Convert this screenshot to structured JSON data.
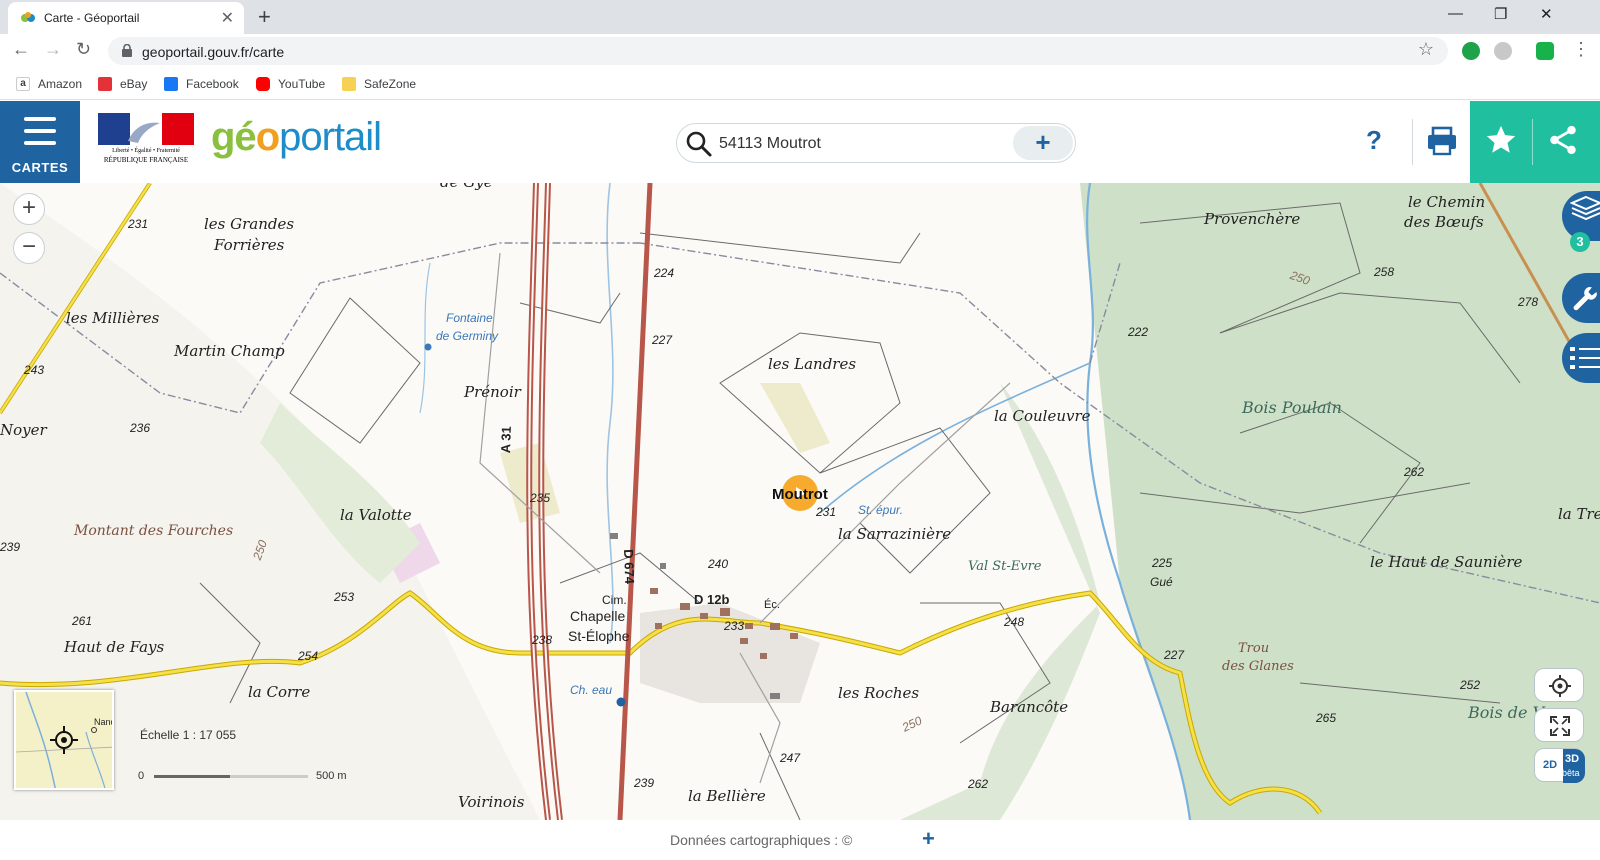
{
  "browser": {
    "tab_title": "Carte - Géoportail",
    "url": "geoportail.gouv.fr/carte",
    "bookmarks": [
      "Amazon",
      "eBay",
      "Facebook",
      "YouTube",
      "SafeZone"
    ]
  },
  "header": {
    "cartes_label": "CARTES",
    "marianne_text_1": "Liberté • Égalité • Fraternité",
    "marianne_text_2": "RÉPUBLIQUE FRANÇAISE",
    "logo_part1": "gé",
    "logo_part2": "o",
    "logo_part3": "portail",
    "search_value": "54113 Moutrot",
    "help_label": "?"
  },
  "map": {
    "labels": {
      "grandes_forrieres": "les Grandes",
      "grandes_forrieres_2": "Forrières",
      "millieres": "les Millières",
      "martin_champ": "Martin Champ",
      "noyer": "Noyer",
      "fontaine": "Fontaine",
      "fontaine_2": "de Germiny",
      "prenoir": "Prénoir",
      "landres": "les Landres",
      "valotte": "la Valotte",
      "montant": "Montant des Fourches",
      "haut_fays": "Haut de Fays",
      "corre": "la Corre",
      "chapelle": "Chapelle",
      "chapelle_2": "St-Élophe",
      "cim": "Cim.",
      "ch_eau": "Ch. eau",
      "moutrot": "Moutrot",
      "st_epur": "St. épur.",
      "sarraziniere": "la Sarrazinière",
      "couleuvre": "la Couleuvre",
      "provenchere": "Provenchère",
      "chemin_boeufs": "le Chemin",
      "chemin_boeufs_2": "des Bœufs",
      "bois_poulain": "Bois Poulain",
      "val_st_evre": "Val St-Evre",
      "haut_sauniere": "le Haut de Saunière",
      "gue": "Gué",
      "trou_glanes": "Trou",
      "trou_glanes_2": "des Glanes",
      "roches": "les Roches",
      "barancote": "Barancôte",
      "belliere": "la Bellière",
      "voirinois": "Voirinois",
      "ec": "Éc.",
      "bois_de_v": "Bois de V",
      "la_tre": "la Tre",
      "de_gye": "de Gye",
      "road_a31": "A 31",
      "road_d674": "D 674",
      "road_d12b": "D 12b",
      "alt_231": "231",
      "alt_243": "243",
      "alt_236": "236",
      "alt_239": "239",
      "alt_261": "261",
      "alt_253": "253",
      "alt_254": "254",
      "alt_250": "250",
      "alt_224": "224",
      "alt_227": "227",
      "alt_235": "235",
      "alt_238": "238",
      "alt_240": "240",
      "alt_233": "233",
      "alt_231b": "231",
      "alt_222": "222",
      "alt_258": "258",
      "alt_278": "278",
      "alt_262": "262",
      "alt_225": "225",
      "alt_248": "248",
      "alt_227b": "227",
      "alt_252": "252",
      "alt_265": "265",
      "alt_247": "247",
      "alt_262b": "262",
      "alt_239b": "239",
      "alt_250b": "250",
      "alt_250c": "250"
    },
    "layer_count": "3",
    "btn_2d": "2D",
    "btn_3d": "3D",
    "btn_3d_beta": "bêta",
    "minimap_label": "Nanc",
    "scale_title": "Échelle 1 : 17 055",
    "scale_zero": "0",
    "scale_max": "500 m",
    "zoom_in": "+",
    "zoom_out": "−"
  },
  "footer": {
    "credits": "Données cartographiques : ©",
    "plus": "+"
  },
  "colors": {
    "brand_blue": "#1f63a0",
    "teal": "#1fbf9f",
    "forest": "#cfe0c8",
    "road_yellow": "#f5e04a",
    "marker": "#f5a623"
  }
}
